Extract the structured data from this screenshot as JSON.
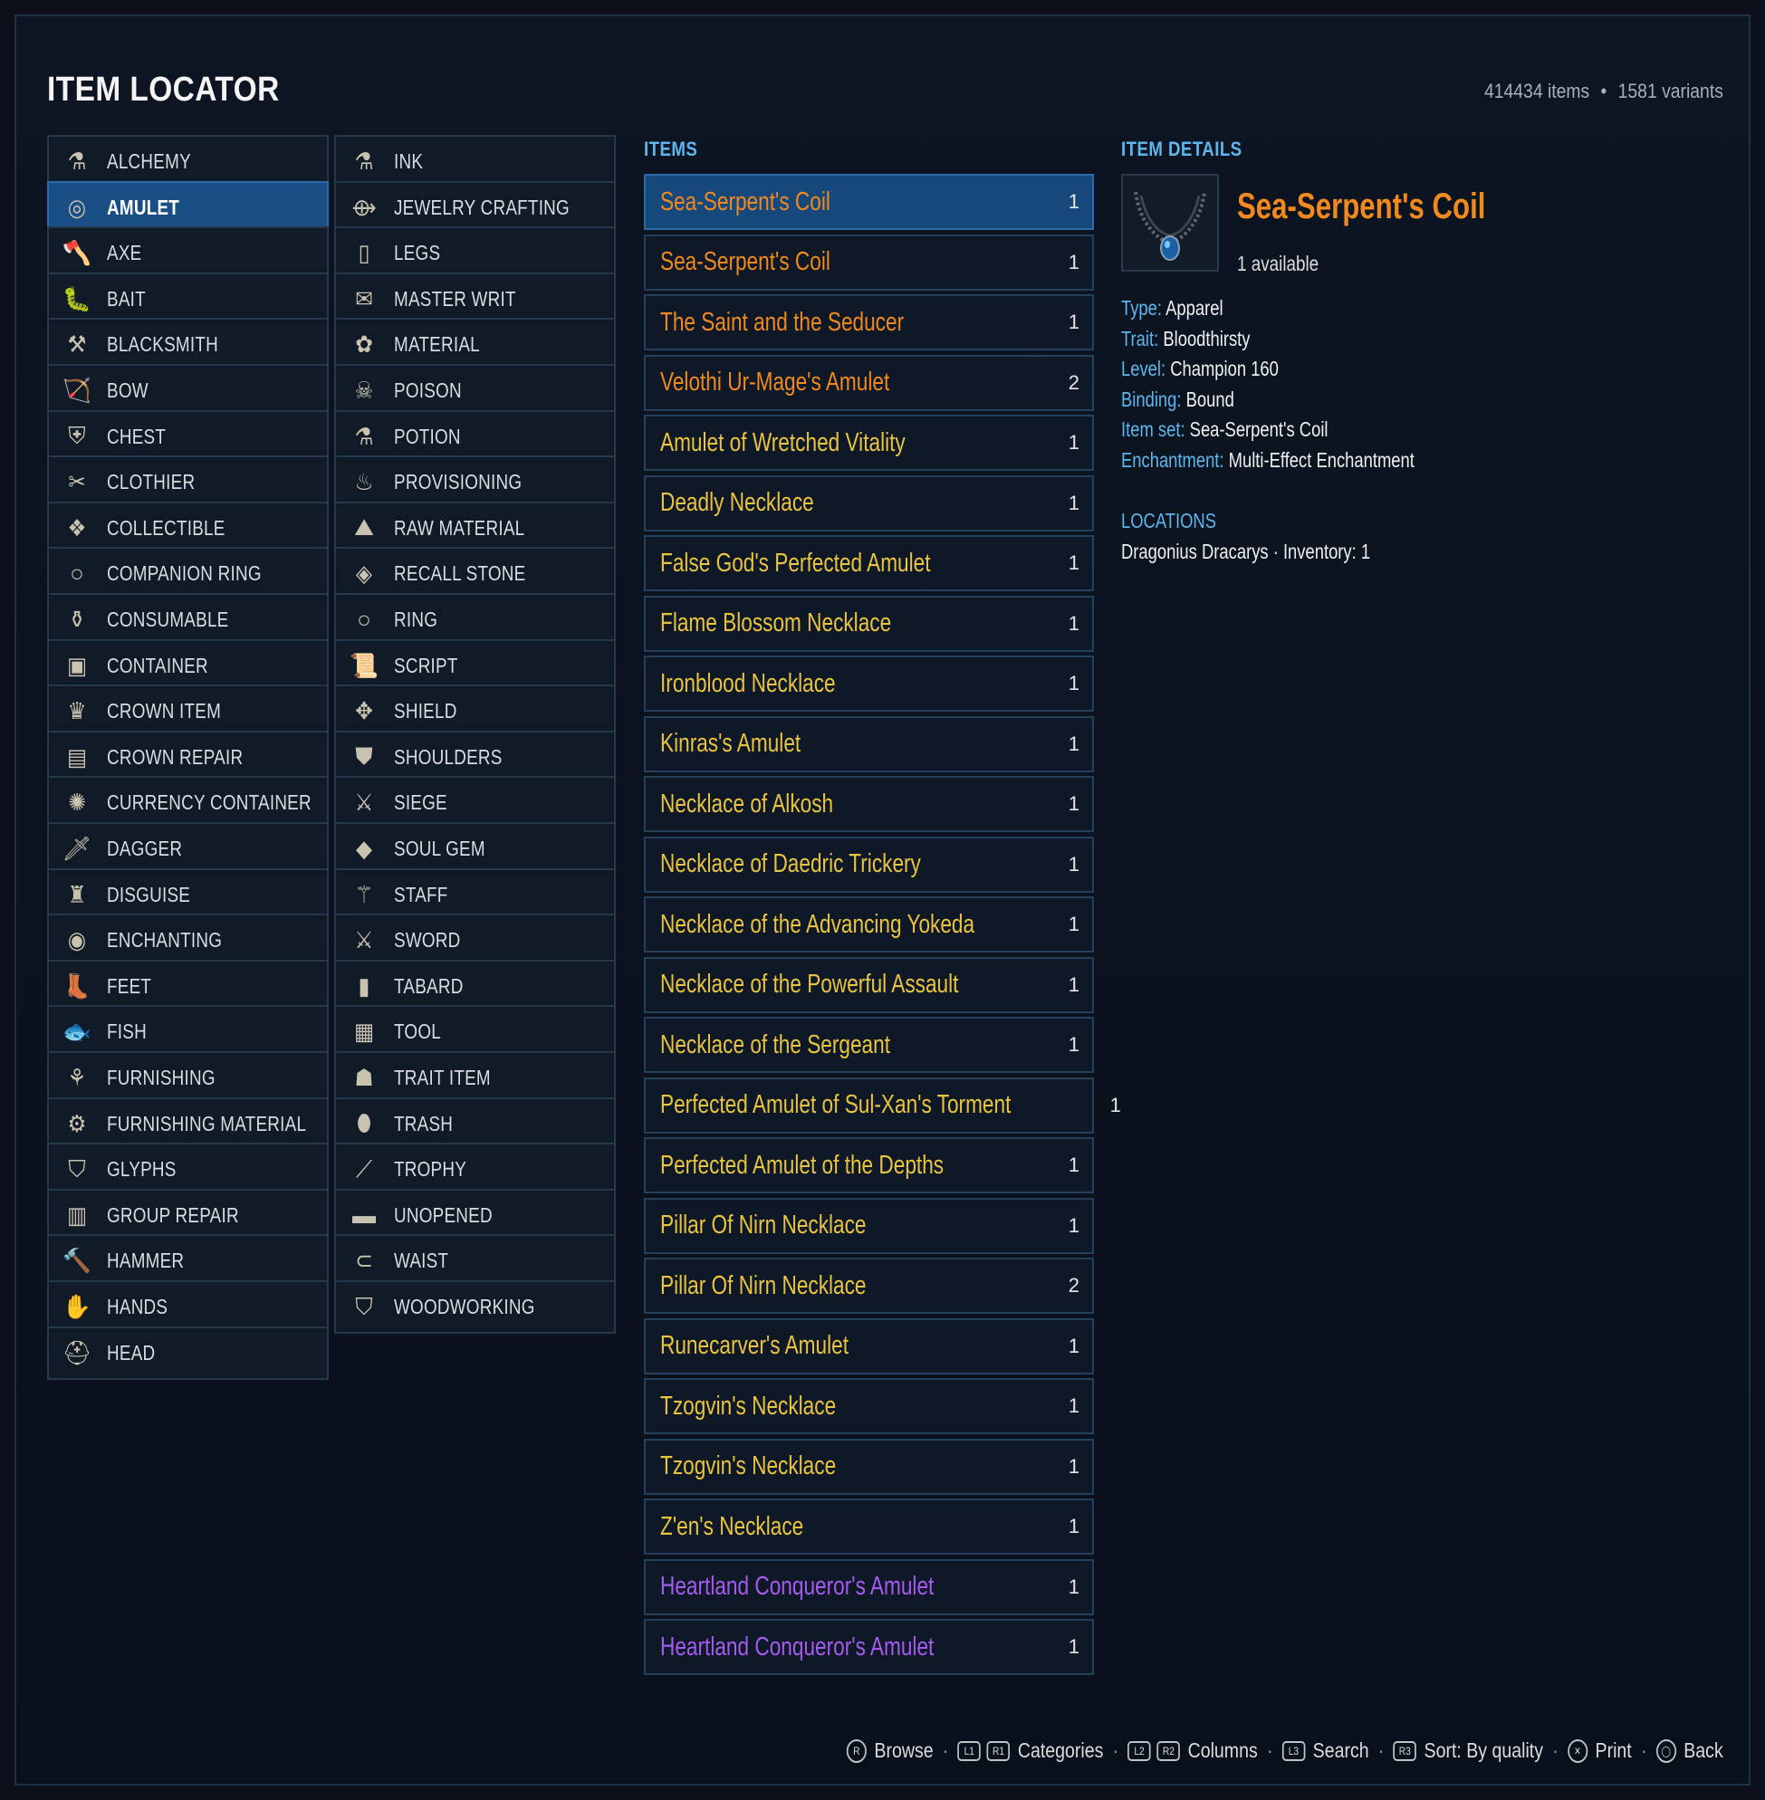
{
  "header": {
    "title": "ITEM LOCATOR",
    "items_count": "414434 items",
    "variants_count": "1581 variants"
  },
  "categories": {
    "column_left": [
      {
        "label": "ALCHEMY",
        "icon": "alchemy-icon",
        "glyph": "⚗"
      },
      {
        "label": "AMULET",
        "icon": "amulet-icon",
        "glyph": "◎",
        "selected": true
      },
      {
        "label": "AXE",
        "icon": "axe-icon",
        "glyph": "🪓"
      },
      {
        "label": "BAIT",
        "icon": "bait-icon",
        "glyph": "🐛"
      },
      {
        "label": "BLACKSMITH",
        "icon": "blacksmith-icon",
        "glyph": "⚒"
      },
      {
        "label": "BOW",
        "icon": "bow-icon",
        "glyph": "🏹"
      },
      {
        "label": "CHEST",
        "icon": "chest-icon",
        "glyph": "⛨"
      },
      {
        "label": "CLOTHIER",
        "icon": "clothier-icon",
        "glyph": "✂"
      },
      {
        "label": "COLLECTIBLE",
        "icon": "collectible-icon",
        "glyph": "❖"
      },
      {
        "label": "COMPANION RING",
        "icon": "companion-ring-icon",
        "glyph": "○"
      },
      {
        "label": "CONSUMABLE",
        "icon": "consumable-icon",
        "glyph": "⚱"
      },
      {
        "label": "CONTAINER",
        "icon": "container-icon",
        "glyph": "▣"
      },
      {
        "label": "CROWN ITEM",
        "icon": "crown-item-icon",
        "glyph": "♛"
      },
      {
        "label": "CROWN REPAIR",
        "icon": "crown-repair-icon",
        "glyph": "▤"
      },
      {
        "label": "CURRENCY CONTAINER",
        "icon": "currency-container-icon",
        "glyph": "✺"
      },
      {
        "label": "DAGGER",
        "icon": "dagger-icon",
        "glyph": "🗡"
      },
      {
        "label": "DISGUISE",
        "icon": "disguise-icon",
        "glyph": "♜"
      },
      {
        "label": "ENCHANTING",
        "icon": "enchanting-icon",
        "glyph": "◉"
      },
      {
        "label": "FEET",
        "icon": "feet-icon",
        "glyph": "👢"
      },
      {
        "label": "FISH",
        "icon": "fish-icon",
        "glyph": "🐟"
      },
      {
        "label": "FURNISHING",
        "icon": "furnishing-icon",
        "glyph": "⚘"
      },
      {
        "label": "FURNISHING MATERIAL",
        "icon": "furnishing-material-icon",
        "glyph": "⚙"
      },
      {
        "label": "GLYPHS",
        "icon": "glyphs-icon",
        "glyph": "⛉"
      },
      {
        "label": "GROUP REPAIR",
        "icon": "group-repair-icon",
        "glyph": "▥"
      },
      {
        "label": "HAMMER",
        "icon": "hammer-icon",
        "glyph": "🔨"
      },
      {
        "label": "HANDS",
        "icon": "hands-icon",
        "glyph": "✋"
      },
      {
        "label": "HEAD",
        "icon": "head-icon",
        "glyph": "⛑"
      }
    ],
    "column_right": [
      {
        "label": "INK",
        "icon": "ink-icon",
        "glyph": "⚗"
      },
      {
        "label": "JEWELRY CRAFTING",
        "icon": "jewelry-crafting-icon",
        "glyph": "⟴"
      },
      {
        "label": "LEGS",
        "icon": "legs-icon",
        "glyph": "▯"
      },
      {
        "label": "MASTER WRIT",
        "icon": "master-writ-icon",
        "glyph": "✉"
      },
      {
        "label": "MATERIAL",
        "icon": "material-icon",
        "glyph": "✿"
      },
      {
        "label": "POISON",
        "icon": "poison-icon",
        "glyph": "☠"
      },
      {
        "label": "POTION",
        "icon": "potion-icon",
        "glyph": "⚗"
      },
      {
        "label": "PROVISIONING",
        "icon": "provisioning-icon",
        "glyph": "♨"
      },
      {
        "label": "RAW MATERIAL",
        "icon": "raw-material-icon",
        "glyph": "⛰"
      },
      {
        "label": "RECALL STONE",
        "icon": "recall-stone-icon",
        "glyph": "◈"
      },
      {
        "label": "RING",
        "icon": "ring-icon",
        "glyph": "○"
      },
      {
        "label": "SCRIPT",
        "icon": "script-icon",
        "glyph": "📜"
      },
      {
        "label": "SHIELD",
        "icon": "shield-icon",
        "glyph": "✥"
      },
      {
        "label": "SHOULDERS",
        "icon": "shoulders-icon",
        "glyph": "⛊"
      },
      {
        "label": "SIEGE",
        "icon": "siege-icon",
        "glyph": "⚔"
      },
      {
        "label": "SOUL GEM",
        "icon": "soul-gem-icon",
        "glyph": "◆"
      },
      {
        "label": "STAFF",
        "icon": "staff-icon",
        "glyph": "⚚"
      },
      {
        "label": "SWORD",
        "icon": "sword-icon",
        "glyph": "⚔"
      },
      {
        "label": "TABARD",
        "icon": "tabard-icon",
        "glyph": "▮"
      },
      {
        "label": "TOOL",
        "icon": "tool-icon",
        "glyph": "▦"
      },
      {
        "label": "TRAIT ITEM",
        "icon": "trait-item-icon",
        "glyph": "☗"
      },
      {
        "label": "TRASH",
        "icon": "trash-icon",
        "glyph": "⬮"
      },
      {
        "label": "TROPHY",
        "icon": "trophy-icon",
        "glyph": "⟋"
      },
      {
        "label": "UNOPENED",
        "icon": "unopened-icon",
        "glyph": "▬"
      },
      {
        "label": "WAIST",
        "icon": "waist-icon",
        "glyph": "⊂"
      },
      {
        "label": "WOODWORKING",
        "icon": "woodworking-icon",
        "glyph": "⛉"
      }
    ]
  },
  "items": {
    "section_label": "ITEMS",
    "list": [
      {
        "name": "Sea-Serpent's Coil",
        "qty": "1",
        "quality": "legendary",
        "selected": true
      },
      {
        "name": "Sea-Serpent's Coil",
        "qty": "1",
        "quality": "legendary"
      },
      {
        "name": "The Saint and the Seducer",
        "qty": "1",
        "quality": "legendary"
      },
      {
        "name": "Velothi Ur-Mage's Amulet",
        "qty": "2",
        "quality": "legendary"
      },
      {
        "name": "Amulet of Wretched Vitality",
        "qty": "1",
        "quality": "gold"
      },
      {
        "name": "Deadly Necklace",
        "qty": "1",
        "quality": "gold"
      },
      {
        "name": "False God's Perfected Amulet",
        "qty": "1",
        "quality": "gold"
      },
      {
        "name": "Flame Blossom Necklace",
        "qty": "1",
        "quality": "gold"
      },
      {
        "name": "Ironblood Necklace",
        "qty": "1",
        "quality": "gold"
      },
      {
        "name": "Kinras's Amulet",
        "qty": "1",
        "quality": "gold"
      },
      {
        "name": "Necklace of Alkosh",
        "qty": "1",
        "quality": "gold"
      },
      {
        "name": "Necklace of Daedric Trickery",
        "qty": "1",
        "quality": "gold"
      },
      {
        "name": "Necklace of the Advancing Yokeda",
        "qty": "1",
        "quality": "gold"
      },
      {
        "name": "Necklace of the Powerful Assault",
        "qty": "1",
        "quality": "gold"
      },
      {
        "name": "Necklace of the Sergeant",
        "qty": "1",
        "quality": "gold"
      },
      {
        "name": "Perfected Amulet of Sul-Xan's Torment",
        "qty": "1",
        "quality": "gold"
      },
      {
        "name": "Perfected Amulet of the Depths",
        "qty": "1",
        "quality": "gold"
      },
      {
        "name": "Pillar Of Nirn Necklace",
        "qty": "1",
        "quality": "gold"
      },
      {
        "name": "Pillar Of Nirn Necklace",
        "qty": "2",
        "quality": "gold"
      },
      {
        "name": "Runecarver's Amulet",
        "qty": "1",
        "quality": "gold"
      },
      {
        "name": "Tzogvin's Necklace",
        "qty": "1",
        "quality": "gold"
      },
      {
        "name": "Tzogvin's Necklace",
        "qty": "1",
        "quality": "gold"
      },
      {
        "name": "Z'en's Necklace",
        "qty": "1",
        "quality": "gold"
      },
      {
        "name": "Heartland Conqueror's Amulet",
        "qty": "1",
        "quality": "epic"
      },
      {
        "name": "Heartland Conqueror's Amulet",
        "qty": "1",
        "quality": "epic"
      }
    ]
  },
  "quality_colors": {
    "legendary": "#f0891e",
    "gold": "#e9c440",
    "epic": "#a55af0"
  },
  "details": {
    "section_label": "ITEM DETAILS",
    "name": "Sea-Serpent's Coil",
    "name_color": "#f0891e",
    "available": "1 available",
    "thumbnail_icon": "necklace-icon",
    "properties": [
      {
        "key": "Type:",
        "value": "Apparel"
      },
      {
        "key": "Trait:",
        "value": "Bloodthirsty"
      },
      {
        "key": "Level:",
        "value": "Champion 160"
      },
      {
        "key": "Binding:",
        "value": "Bound"
      },
      {
        "key": "Item set:",
        "value": "Sea-Serpent's Coil"
      },
      {
        "key": "Enchantment:",
        "value": "Multi-Effect Enchantment"
      }
    ],
    "locations_label": "LOCATIONS",
    "location": "Dragonius Dracarys · Inventory: 1"
  },
  "footer": {
    "hints": [
      {
        "buttons": [
          "R"
        ],
        "label": "Browse"
      },
      {
        "buttons": [
          "L1",
          "R1"
        ],
        "label": "Categories"
      },
      {
        "buttons": [
          "L2",
          "R2"
        ],
        "label": "Columns"
      },
      {
        "buttons": [
          "L3"
        ],
        "label": "Search"
      },
      {
        "buttons": [
          "R3"
        ],
        "label": "Sort: By quality"
      },
      {
        "buttons": [
          "✕"
        ],
        "label": "Print"
      },
      {
        "buttons": [
          "◯"
        ],
        "label": "Back"
      }
    ]
  },
  "colors": {
    "accent": "#5eb6ee",
    "selected_bg": "#1a4f86",
    "background": "#0b101a"
  }
}
